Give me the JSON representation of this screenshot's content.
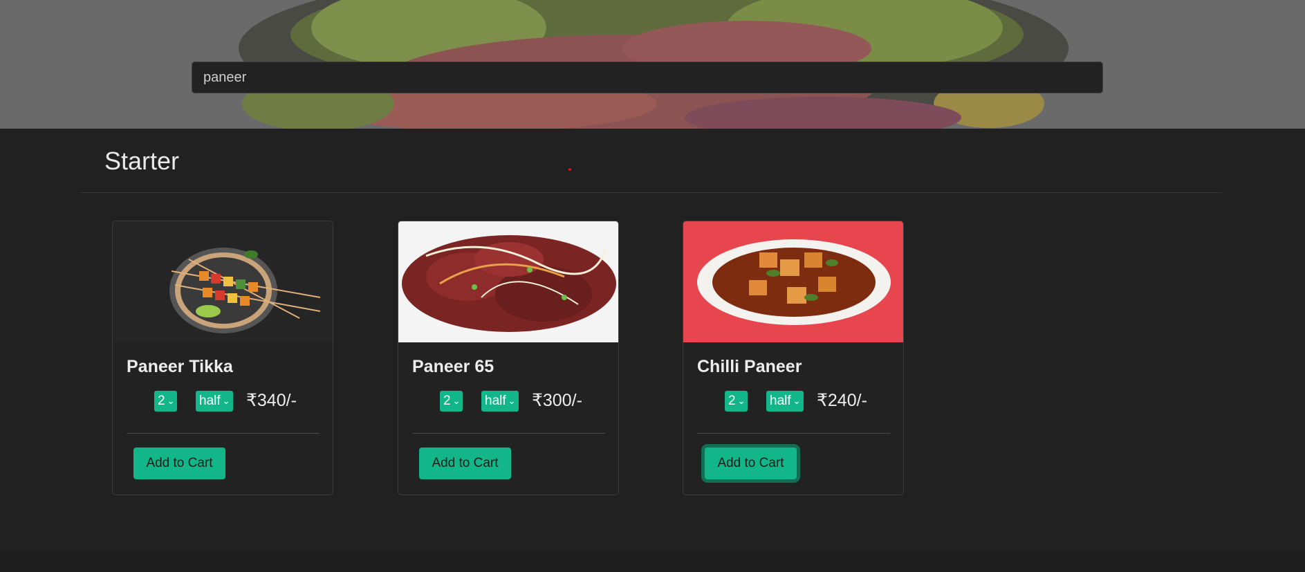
{
  "search": {
    "value": "paneer",
    "placeholder": "Search"
  },
  "category": {
    "title": "Starter"
  },
  "items": [
    {
      "name": "Paneer Tikka",
      "quantity": "2",
      "size": "half",
      "price": "₹340/-",
      "button": "Add to Cart",
      "image": "paneer-tikka-skewers"
    },
    {
      "name": "Paneer 65",
      "quantity": "2",
      "size": "half",
      "price": "₹300/-",
      "button": "Add to Cart",
      "image": "paneer-65-fried"
    },
    {
      "name": "Chilli Paneer",
      "quantity": "2",
      "size": "half",
      "price": "₹240/-",
      "button": "Add to Cart",
      "image": "chilli-paneer-bowl"
    }
  ],
  "colors": {
    "background": "#212121",
    "accent": "#13b688"
  },
  "icons": {
    "dropdown": "chevron-down-icon"
  }
}
